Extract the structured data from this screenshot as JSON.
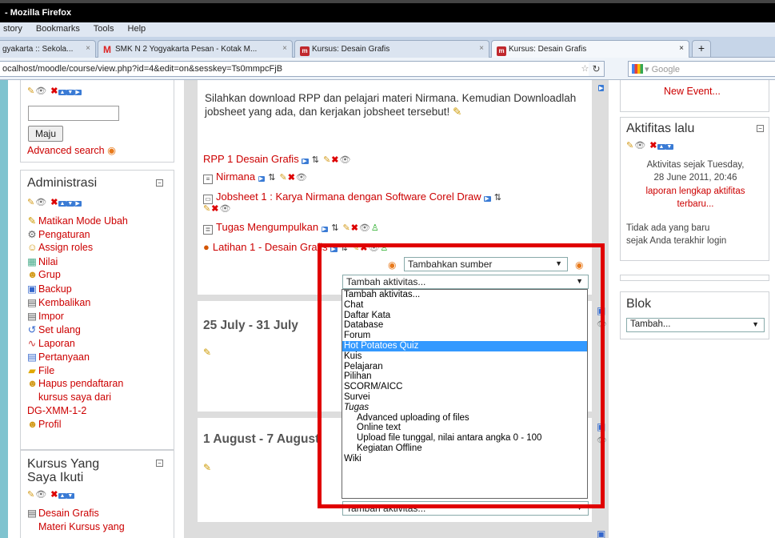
{
  "browser": {
    "title": "- Mozilla Firefox",
    "menu": [
      "story",
      "Bookmarks",
      "Tools",
      "Help"
    ],
    "tabs": [
      {
        "label": "gyakarta :: Sekola...",
        "icon": "none"
      },
      {
        "label": "SMK N 2 Yogyakarta Pesan - Kotak M...",
        "icon": "gmail"
      },
      {
        "label": "Kursus: Desain Grafis",
        "icon": "moodle"
      },
      {
        "label": "Kursus: Desain Grafis",
        "icon": "moodle"
      }
    ],
    "url": "ocalhost/moodle/course/view.php?id=4&edit=on&sesskey=Ts0mmpcFjB",
    "search_placeholder": "Google"
  },
  "left": {
    "search_button": "Maju",
    "advanced_search": "Advanced search",
    "admin": {
      "title": "Administrasi",
      "items": [
        {
          "label": "Matikan Mode Ubah",
          "icon": "pencil-icon"
        },
        {
          "label": "Pengaturan",
          "icon": "wrench-icon"
        },
        {
          "label": "Assign roles",
          "icon": "users-icon"
        },
        {
          "label": "Nilai",
          "icon": "grades-icon"
        },
        {
          "label": "Grup",
          "icon": "group-icon"
        },
        {
          "label": "Backup",
          "icon": "backup-icon"
        },
        {
          "label": "Kembalikan",
          "icon": "restore-icon"
        },
        {
          "label": "Impor",
          "icon": "import-icon"
        },
        {
          "label": "Set ulang",
          "icon": "reset-icon"
        },
        {
          "label": "Laporan",
          "icon": "report-icon"
        },
        {
          "label": "Pertanyaan",
          "icon": "questions-icon"
        },
        {
          "label": "File",
          "icon": "folder-icon"
        },
        {
          "label": "Hapus pendaftaran",
          "icon": "user-icon"
        },
        {
          "label": "kursus saya dari",
          "icon": "none"
        },
        {
          "label": "DG-XMM-1-2",
          "icon": "none"
        },
        {
          "label": "Profil",
          "icon": "user-icon"
        }
      ]
    },
    "courses": {
      "title_line1": "Kursus Yang",
      "title_line2": "Saya Ikuti",
      "items": [
        "Desain Grafis",
        "Materi Kursus yang"
      ]
    }
  },
  "main": {
    "intro": "Silahkan download RPP dan pelajari materi Nirmana. Kemudian Downloadlah jobsheet yang ada, dan kerjakan jobsheet tersebut!",
    "resources": [
      {
        "label": "RPP 1 Desain Grafis",
        "icon": "none"
      },
      {
        "label": "Nirmana",
        "icon": "page-icon"
      },
      {
        "label": "Jobsheet 1 : Karya Nirmana dengan Software Corel Draw",
        "icon": "file-icon"
      },
      {
        "label": "Tugas Mengumpulkan",
        "icon": "assignment-icon"
      },
      {
        "label": "Latihan 1 - Desain Grafis",
        "icon": "quiz-icon"
      }
    ],
    "add_resource": "Tambahkan sumber",
    "add_activity": "Tambah aktivitas...",
    "weeks": [
      "25 July - 31 July",
      "1 August - 7 August"
    ],
    "bottom_select": "Tambah aktivitas...",
    "dropdown_options": [
      {
        "label": "Tambah aktivitas...",
        "kind": "option"
      },
      {
        "label": "Chat",
        "kind": "option"
      },
      {
        "label": "Daftar Kata",
        "kind": "option"
      },
      {
        "label": "Database",
        "kind": "option"
      },
      {
        "label": "Forum",
        "kind": "option"
      },
      {
        "label": "Hot Potatoes Quiz",
        "kind": "highlighted"
      },
      {
        "label": "Kuis",
        "kind": "option"
      },
      {
        "label": "Pelajaran",
        "kind": "option"
      },
      {
        "label": "Pilihan",
        "kind": "option"
      },
      {
        "label": "SCORM/AICC",
        "kind": "option"
      },
      {
        "label": "Survei",
        "kind": "option"
      },
      {
        "label": "Tugas",
        "kind": "group"
      },
      {
        "label": "Advanced uploading of files",
        "kind": "sub"
      },
      {
        "label": "Online text",
        "kind": "sub"
      },
      {
        "label": "Upload file tunggal, nilai antara angka 0 - 100",
        "kind": "sub"
      },
      {
        "label": "Kegiatan Offline",
        "kind": "sub"
      },
      {
        "label": "Wiki",
        "kind": "option"
      }
    ]
  },
  "right": {
    "new_event": "New Event...",
    "recent": {
      "title": "Aktifitas lalu",
      "since_line1": "Aktivitas sejak Tuesday,",
      "since_line2": "28 June 2011, 20:46",
      "report_line1": "laporan lengkap aktifitas",
      "report_line2": "terbaru...",
      "nothing_line1": "Tidak ada yang baru",
      "nothing_line2": "sejak Anda terakhir login"
    },
    "blocks": {
      "title": "Blok",
      "select": "Tambah..."
    }
  }
}
